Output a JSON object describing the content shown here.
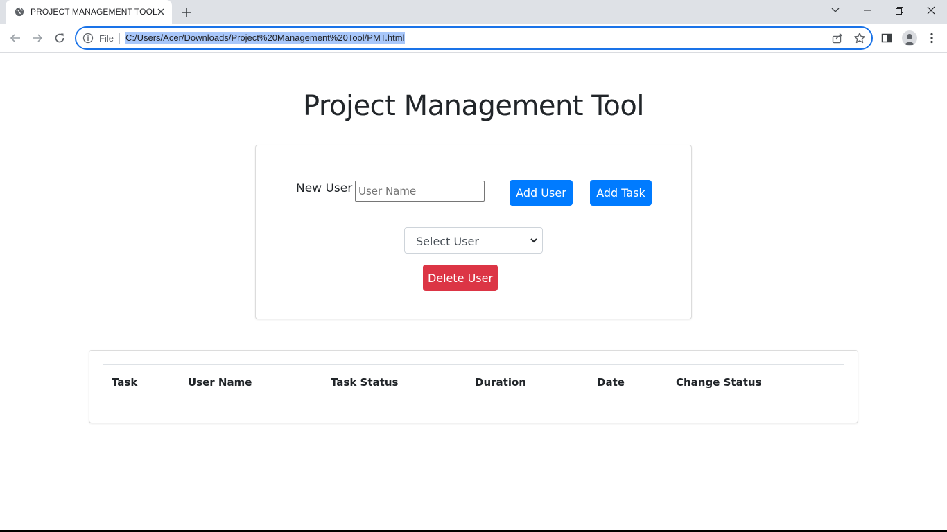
{
  "browser": {
    "tab_title": "PROJECT MANAGEMENT TOOL",
    "omnibox_scheme": "File",
    "url": "C:/Users/Acer/Downloads/Project%20Management%20Tool/PMT.html",
    "accent_color": "#1a73e8"
  },
  "page": {
    "title": "Project Management Tool"
  },
  "form": {
    "new_user_label": "New User :",
    "username_placeholder": "User Name",
    "add_user_label": "Add User",
    "add_task_label": "Add Task",
    "select_user_value": "Select User",
    "delete_user_label": "Delete User",
    "primary_color": "#007bff",
    "danger_color": "#dc3545"
  },
  "table": {
    "headers": [
      "Task",
      "User Name",
      "Task Status",
      "Duration",
      "Date",
      "Change Status"
    ],
    "rows": []
  }
}
